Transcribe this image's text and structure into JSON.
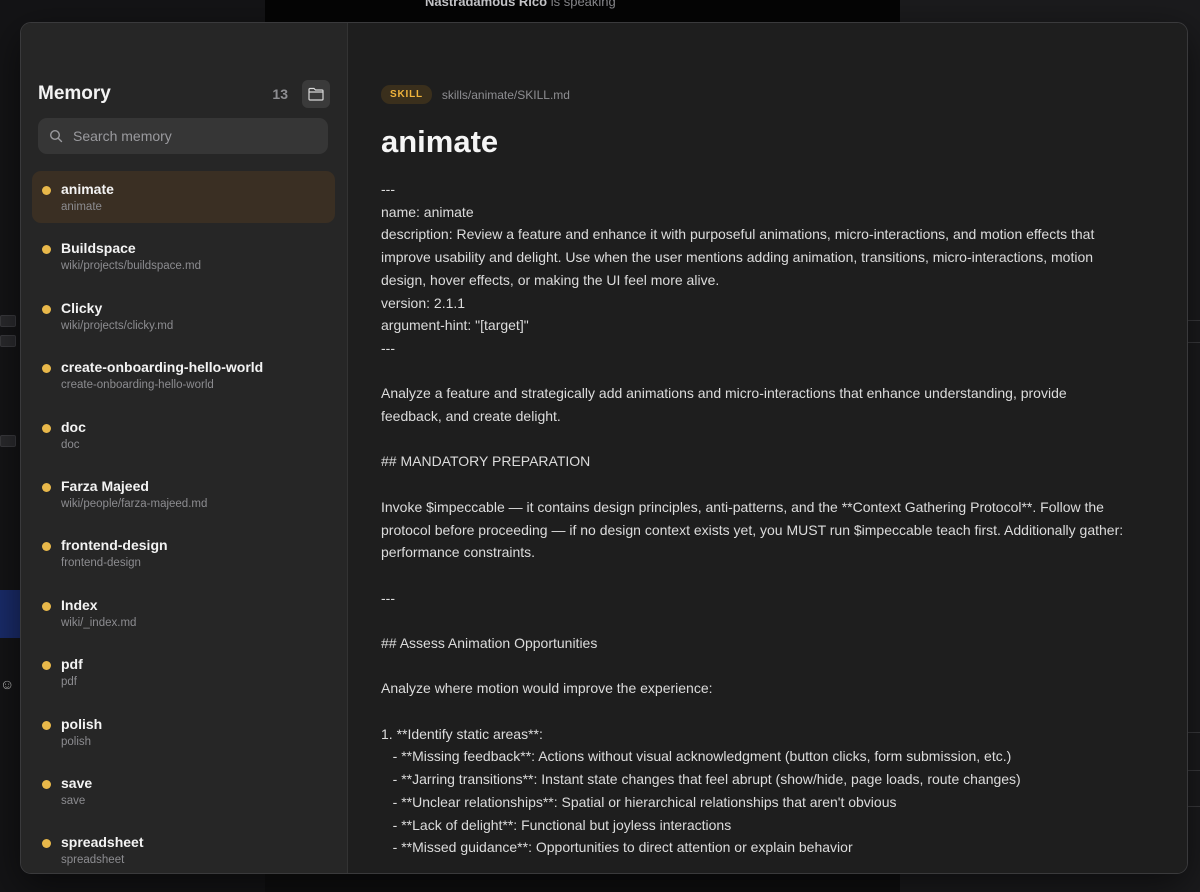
{
  "background": {
    "speaker_name": "Nastradamous Rico",
    "speaker_status": "is speaking"
  },
  "window": {
    "traffic_lights": [
      "close",
      "minimize",
      "zoom"
    ]
  },
  "sidebar": {
    "title": "Memory",
    "count": "13",
    "folder_icon": "folder-icon",
    "search": {
      "placeholder": "Search memory",
      "value": ""
    },
    "items": [
      {
        "name": "animate",
        "path": "animate",
        "active": true
      },
      {
        "name": "Buildspace",
        "path": "wiki/projects/buildspace.md"
      },
      {
        "name": "Clicky",
        "path": "wiki/projects/clicky.md"
      },
      {
        "name": "create-onboarding-hello-world",
        "path": "create-onboarding-hello-world"
      },
      {
        "name": "doc",
        "path": "doc"
      },
      {
        "name": "Farza Majeed",
        "path": "wiki/people/farza-majeed.md"
      },
      {
        "name": "frontend-design",
        "path": "frontend-design"
      },
      {
        "name": "Index",
        "path": "wiki/_index.md"
      },
      {
        "name": "pdf",
        "path": "pdf"
      },
      {
        "name": "polish",
        "path": "polish"
      },
      {
        "name": "save",
        "path": "save"
      },
      {
        "name": "spreadsheet",
        "path": "spreadsheet"
      }
    ]
  },
  "document": {
    "badge": "SKILL",
    "path": "skills/animate/SKILL.md",
    "title": "animate",
    "lines": [
      "---",
      "name: animate",
      "description: Review a feature and enhance it with purposeful animations, micro-interactions, and motion effects that",
      "improve usability and delight. Use when the user mentions adding animation, transitions, micro-interactions, motion",
      "design, hover effects, or making the UI feel more alive.",
      "version: 2.1.1",
      "argument-hint: \"[target]\"",
      "---",
      "",
      "Analyze a feature and strategically add animations and micro-interactions that enhance understanding, provide",
      "feedback, and create delight.",
      "",
      "## MANDATORY PREPARATION",
      "",
      "Invoke $impeccable — it contains design principles, anti-patterns, and the **Context Gathering Protocol**. Follow the",
      "protocol before proceeding — if no design context exists yet, you MUST run $impeccable teach first. Additionally gather:",
      "performance constraints.",
      "",
      "---",
      "",
      "## Assess Animation Opportunities",
      "",
      "Analyze where motion would improve the experience:",
      "",
      "1. **Identify static areas**:",
      "   - **Missing feedback**: Actions without visual acknowledgment (button clicks, form submission, etc.)",
      "   - **Jarring transitions**: Instant state changes that feel abrupt (show/hide, page loads, route changes)",
      "   - **Unclear relationships**: Spatial or hierarchical relationships that aren't obvious",
      "   - **Lack of delight**: Functional but joyless interactions",
      "   - **Missed guidance**: Opportunities to direct attention or explain behavior"
    ]
  }
}
